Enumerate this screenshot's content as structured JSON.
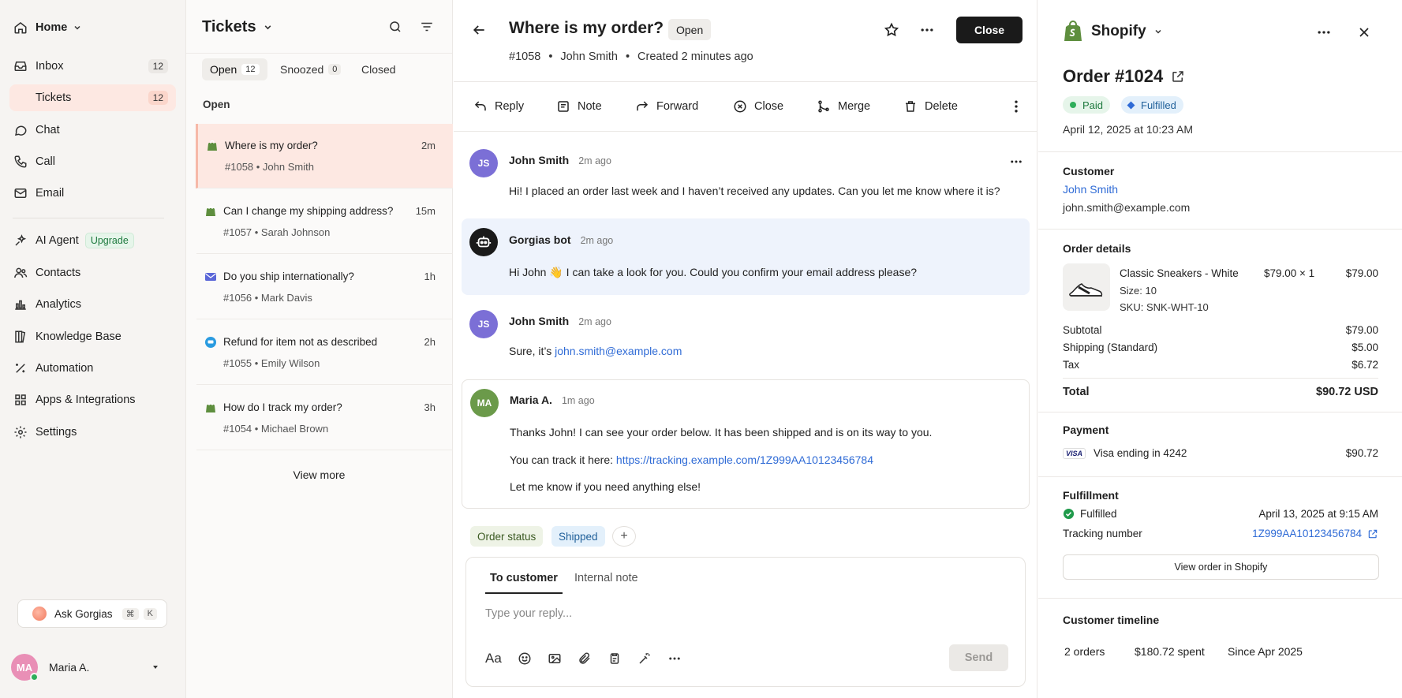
{
  "nav": {
    "home": "Home",
    "items": [
      {
        "label": "Inbox",
        "count": "12"
      },
      {
        "label": "Tickets",
        "count": "12"
      },
      {
        "label": "Chat"
      },
      {
        "label": "Call"
      },
      {
        "label": "Email"
      }
    ],
    "items2": [
      {
        "label": "AI Agent",
        "badge": "Upgrade"
      },
      {
        "label": "Contacts"
      },
      {
        "label": "Analytics"
      },
      {
        "label": "Knowledge Base"
      },
      {
        "label": "Automation"
      },
      {
        "label": "Apps & Integrations"
      },
      {
        "label": "Settings"
      }
    ],
    "ask": {
      "label": "Ask Gorgias",
      "key1": "⌘",
      "key2": "K"
    },
    "user": {
      "initials": "MA",
      "name": "Maria A."
    }
  },
  "list": {
    "title": "Tickets",
    "tabs": [
      {
        "label": "Open",
        "count": "12"
      },
      {
        "label": "Snoozed",
        "count": "0"
      },
      {
        "label": "Closed"
      }
    ],
    "section": "Open",
    "tickets": [
      {
        "title": "Where is my order?",
        "sub": "#1058 • John Smith",
        "time": "2m",
        "channel": "shopify"
      },
      {
        "title": "Can I change my shipping address?",
        "sub": "#1057 • Sarah Johnson",
        "time": "15m",
        "channel": "shopify"
      },
      {
        "title": "Do you ship internationally?",
        "sub": "#1056 • Mark Davis",
        "time": "1h",
        "channel": "email"
      },
      {
        "title": "Refund for item not as described",
        "sub": "#1055 • Emily Wilson",
        "time": "2h",
        "channel": "chat"
      },
      {
        "title": "How do I track my order?",
        "sub": "#1054 • Michael Brown",
        "time": "3h",
        "channel": "shopify"
      }
    ],
    "view_more": "View more"
  },
  "ticket": {
    "title": "Where is my order?",
    "status": "Open",
    "id": "#1058",
    "customer": "John Smith",
    "created": "Created 2 minutes ago",
    "close_label": "Close",
    "toolbar": [
      "Reply",
      "Note",
      "Forward",
      "Close",
      "Merge",
      "Delete"
    ],
    "messages": [
      {
        "initials": "JS",
        "name": "John Smith",
        "time": "2m ago",
        "text": "Hi! I placed an order last week and I haven’t received any updates. Can you let me know where it is?"
      },
      {
        "name": "Gorgias bot",
        "time": "2m ago",
        "text": "Hi John 👋 I can take a look for you. Could you confirm your email address please?"
      },
      {
        "initials": "JS",
        "name": "John Smith",
        "time": "2m ago",
        "text_prefix": "Sure, it’s ",
        "link": "john.smith@example.com"
      },
      {
        "initials": "MA",
        "name": "Maria A.",
        "time": "1m ago",
        "line1": "Thanks John! I can see your order below. It has been shipped and is on its way to you.",
        "line2_prefix": "You can track it here: ",
        "line2_link": "https://tracking.example.com/1Z999AA10123456784",
        "line3": "Let me know if you need anything else!"
      }
    ],
    "tags": [
      {
        "label": "Order status"
      },
      {
        "label": "Shipped"
      }
    ],
    "add_tag": "+",
    "reply": {
      "tab_customer": "To customer",
      "tab_note": "Internal note",
      "placeholder": "Type your reply...",
      "send": "Send",
      "format": "Aa"
    }
  },
  "shopify": {
    "store": "Shopify",
    "order_title": "Order #1024",
    "paid": "Paid",
    "fulfilled": "Fulfilled",
    "date": "April 12, 2025 at 10:23 AM",
    "customer_label": "Customer",
    "customer_name": "John Smith",
    "customer_email": "john.smith@example.com",
    "details_label": "Order details",
    "product": {
      "name": "Classic Sneakers - White",
      "size": "Size: 10",
      "sku": "SKU: SNK-WHT-10",
      "unit": "$79.00 × 1",
      "total": "$79.00"
    },
    "subtotal_label": "Subtotal",
    "subtotal": "$79.00",
    "shipping_label": "Shipping (Standard)",
    "shipping": "$5.00",
    "tax_label": "Tax",
    "tax": "$6.72",
    "total_label": "Total",
    "total": "$90.72 USD",
    "payment_label": "Payment",
    "card_brand": "VISA",
    "card": "Visa ending in 4242",
    "payment_amount": "$90.72",
    "fulfillment_label": "Fulfillment",
    "fulfillment_status": "Fulfilled",
    "fulfillment_date": "April 13, 2025 at 9:15 AM",
    "tracking_label": "Tracking number",
    "tracking_number": "1Z999AA10123456784",
    "view_order": "View order in Shopify",
    "timeline_label": "Customer timeline",
    "timeline": [
      "2 orders",
      "$180.72 spent",
      "Since Apr 2025"
    ]
  },
  "colors": {
    "accent_bg": "#fde8e2",
    "link": "#2f6bd6",
    "shopify_green": "#5e8e3e",
    "paid_green": "#1f7a3f",
    "bot_bubble": "#eef3fc"
  }
}
